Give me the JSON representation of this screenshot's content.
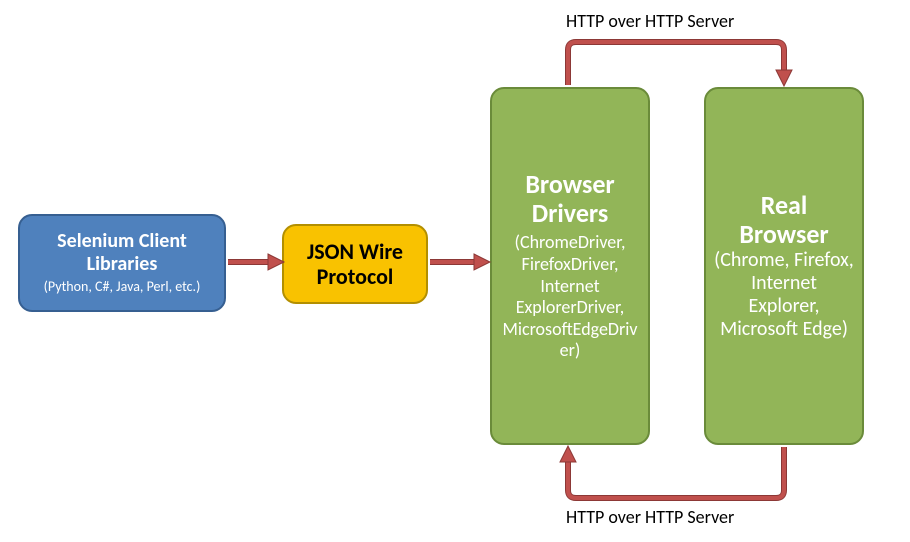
{
  "diagram": {
    "blocks": {
      "client": {
        "title": "Selenium Client Libraries",
        "subtitle": "(Python, C#, Java, Perl, etc.)"
      },
      "json": {
        "title": "JSON Wire Protocol"
      },
      "drivers": {
        "title": "Browser Drivers",
        "subtitle": "(ChromeDriver, FirefoxDriver, Internet ExplorerDriver, MicrosoftEdgeDriver)"
      },
      "browser": {
        "title": "Real Browser",
        "subtitle": "(Chrome, Firefox, Internet Explorer, Microsoft Edge)"
      }
    },
    "labels": {
      "top": "HTTP over HTTP Server",
      "bottom": "HTTP over HTTP Server"
    }
  }
}
